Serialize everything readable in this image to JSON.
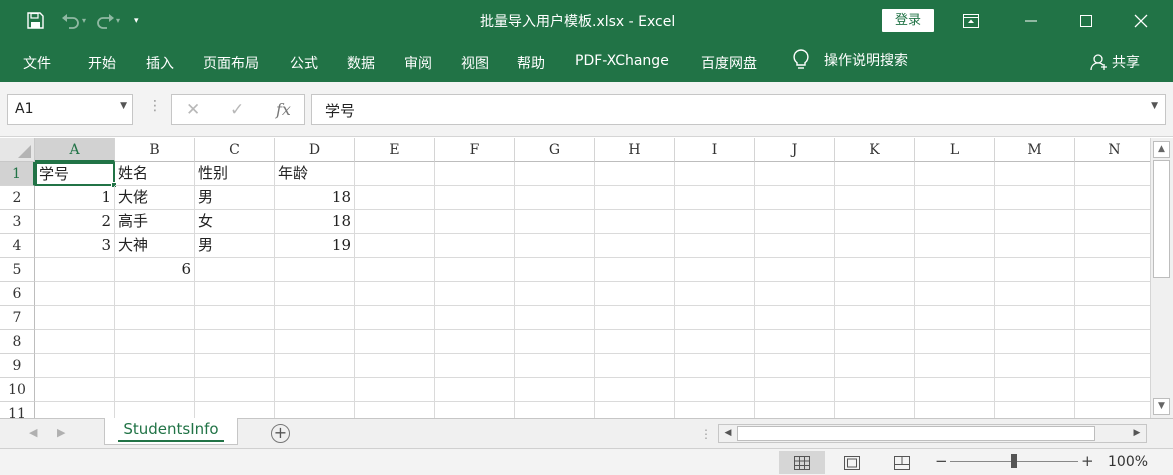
{
  "window": {
    "title": "批量导入用户模板.xlsx  -  Excel",
    "login_label": "登录"
  },
  "ribbon": {
    "tabs": [
      "文件",
      "开始",
      "插入",
      "页面布局",
      "公式",
      "数据",
      "审阅",
      "视图",
      "帮助",
      "PDF-XChange",
      "百度网盘"
    ],
    "tell_me": "操作说明搜索",
    "share": "共享"
  },
  "formula_bar": {
    "name_box": "A1",
    "content": "学号"
  },
  "sheet": {
    "columns": [
      "A",
      "B",
      "C",
      "D",
      "E",
      "F",
      "G",
      "H",
      "I",
      "J",
      "K",
      "L",
      "M",
      "N"
    ],
    "rows": [
      "1",
      "2",
      "3",
      "4",
      "5",
      "6",
      "7",
      "8",
      "9",
      "10",
      "11"
    ],
    "cells": {
      "A1": "学号",
      "B1": "姓名",
      "C1": "性别",
      "D1": "年龄",
      "A2": "1",
      "B2": "大佬",
      "C2": "男",
      "D2": "18",
      "A3": "2",
      "B3": "高手",
      "C3": "女",
      "D3": "18",
      "A4": "3",
      "B4": "大神",
      "C4": "男",
      "D4": "19",
      "B5": "6"
    },
    "numeric_cells": [
      "A2",
      "A3",
      "A4",
      "D2",
      "D3",
      "D4",
      "B5"
    ],
    "active_cell": "A1"
  },
  "sheet_tabs": {
    "active": "StudentsInfo"
  },
  "status": {
    "zoom": "100%"
  },
  "colors": {
    "accent": "#217346"
  }
}
